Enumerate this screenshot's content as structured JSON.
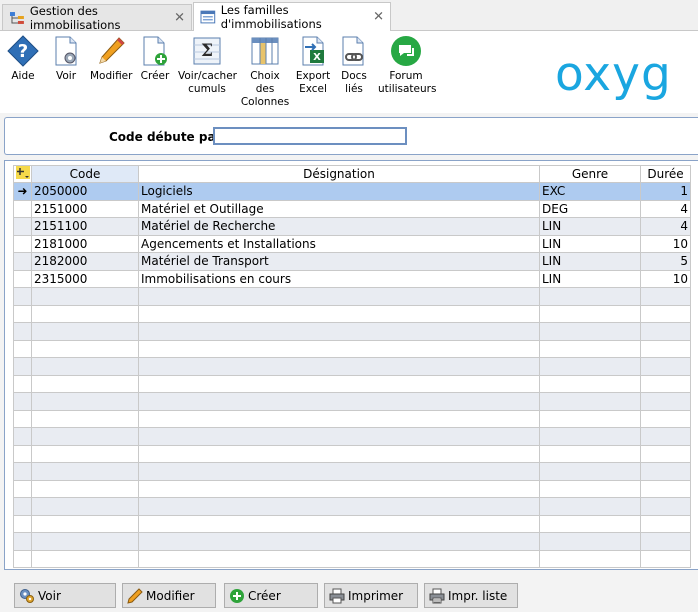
{
  "tabs": [
    {
      "label": "Gestion des immobilisations",
      "active": false
    },
    {
      "label": "Les familles d'immobilisations",
      "active": true
    }
  ],
  "toolbar": {
    "aide": "Aide",
    "voir": "Voir",
    "modifier": "Modifier",
    "creer": "Créer",
    "cumuls_line1": "Voir/cacher",
    "cumuls_line2": "cumuls",
    "choix_line1": "Choix",
    "choix_line2": "des",
    "choix_line3": "Colonnes",
    "export_line1": "Export",
    "export_line2": "Excel",
    "docs_line1": "Docs",
    "docs_line2": "liés",
    "forum_line1": "Forum",
    "forum_line2": "utilisateurs"
  },
  "logo": {
    "text": "oxyg",
    "color": "#1aa6e0"
  },
  "search": {
    "label": "Code débute par",
    "value": ""
  },
  "grid": {
    "columns": [
      "Code",
      "Désignation",
      "Genre",
      "Durée"
    ],
    "rows": [
      {
        "code": "2050000",
        "designation": "Logiciels",
        "genre": "EXC",
        "duree": "1"
      },
      {
        "code": "2151000",
        "designation": "Matériel et Outillage",
        "genre": "DEG",
        "duree": "4"
      },
      {
        "code": "2151100",
        "designation": "Matériel de Recherche",
        "genre": "LIN",
        "duree": "4"
      },
      {
        "code": "2181000",
        "designation": "Agencements et Installations",
        "genre": "LIN",
        "duree": "10"
      },
      {
        "code": "2182000",
        "designation": "Matériel de Transport",
        "genre": "LIN",
        "duree": "5"
      },
      {
        "code": "2315000",
        "designation": "Immobilisations en cours",
        "genre": "LIN",
        "duree": "10"
      }
    ],
    "selected_row": 0
  },
  "buttons": {
    "voir": "Voir",
    "modifier": "Modifier",
    "creer": "Créer",
    "imprimer": "Imprimer",
    "impr_liste": "Impr. liste"
  },
  "colors": {
    "accent": "#1aa6e0",
    "selection": "#aecbf0",
    "header_code": "#dfe9f7"
  }
}
